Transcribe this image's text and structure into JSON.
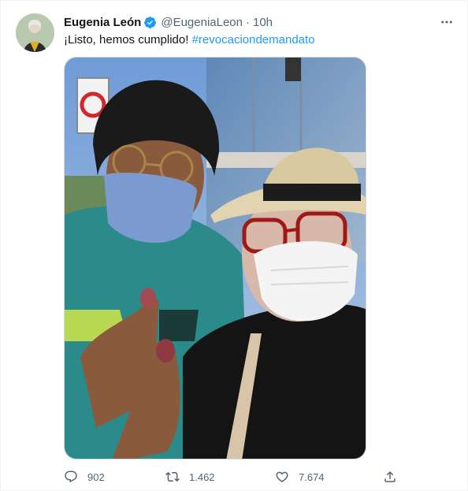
{
  "tweet": {
    "author_name": "Eugenia León",
    "handle": "@EugeniaLeon",
    "separator": "·",
    "time": "10h",
    "text": "¡Listo, hemos cumplido! ",
    "hashtag": "#revocaciondemandato",
    "media_alt": "Selfie of two people wearing face masks showing inked thumbs"
  },
  "actions": {
    "replies": "902",
    "retweets": "1.462",
    "likes": "7.674"
  },
  "colors": {
    "accent": "#1d9bf0",
    "secondary_text": "#536471",
    "primary_text": "#0f1419"
  },
  "icons": {
    "verified": "verified-badge-icon",
    "more": "more-options-icon",
    "reply": "reply-icon",
    "retweet": "retweet-icon",
    "like": "heart-icon",
    "share": "share-icon"
  }
}
